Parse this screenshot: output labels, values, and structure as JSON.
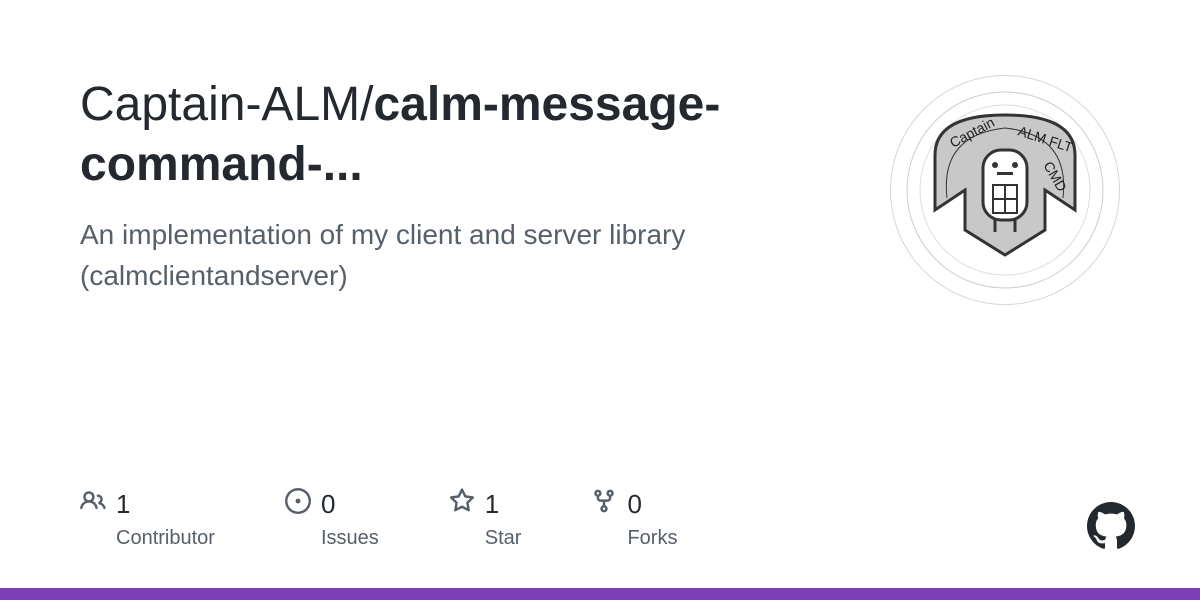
{
  "repo": {
    "owner": "Captain-ALM",
    "separator": "/",
    "name_display": "calm-message-command-...",
    "description": "An implementation of my client and server library (calmclientandserver)"
  },
  "avatar": {
    "text_left": "Captain",
    "text_right": "ALM FLT CMD"
  },
  "stats": {
    "contributors": {
      "count": "1",
      "label": "Contributor"
    },
    "issues": {
      "count": "0",
      "label": "Issues"
    },
    "stars": {
      "count": "1",
      "label": "Star"
    },
    "forks": {
      "count": "0",
      "label": "Forks"
    }
  },
  "accent_color": "#7a3fb3"
}
